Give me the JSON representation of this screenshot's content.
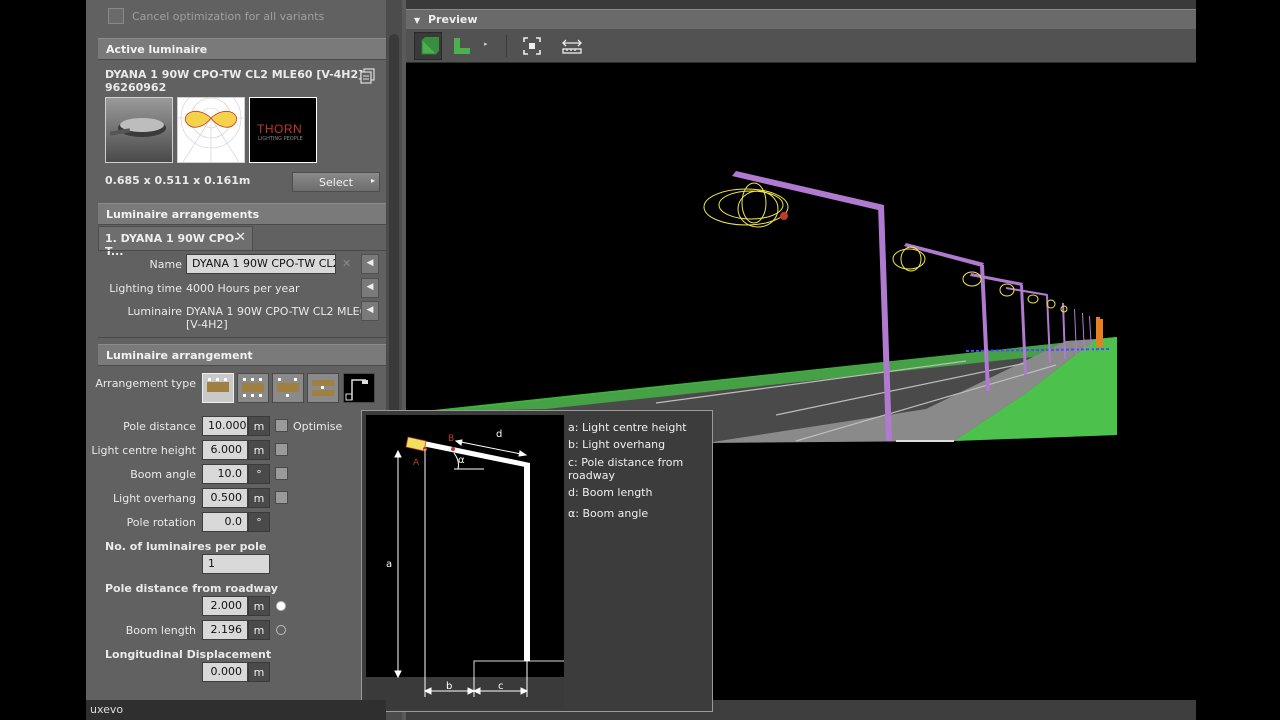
{
  "left_panel": {
    "cancel_label": "Cancel optimization for all variants",
    "active_luminaire": {
      "section_title": "Active luminaire",
      "name_line1": "DYANA 1 90W CPO-TW CL2 MLE60 [V-4H2]",
      "name_line2": "96260962",
      "dimensions": "0.685 x 0.511 x 0.161m",
      "select_label": "Select",
      "logo_text": "THORN",
      "logo_sub": "LIGHTING PEOPLE"
    },
    "arrangements": {
      "section_title": "Luminaire arrangements",
      "tab_label": "1. DYANA 1 90W CPO-T...",
      "tab_close": "✕",
      "name_label": "Name",
      "name_value": "DYANA 1 90W CPO-TW CL2 MLE60 [V-4H2]",
      "lighting_time_label": "Lighting time",
      "lighting_time_value": "4000 Hours per year",
      "luminaire_label": "Luminaire",
      "luminaire_value_line1": "DYANA 1 90W CPO-TW CL2 MLE60",
      "luminaire_value_line2": "[V-4H2]"
    },
    "arrangement": {
      "section_title": "Luminaire arrangement",
      "type_label": "Arrangement type",
      "pole_distance_label": "Pole distance",
      "pole_distance_value": "10.000",
      "pole_distance_unit": "m",
      "optimise_label": "Optimise",
      "light_centre_height_label": "Light centre height",
      "light_centre_height_value": "6.000",
      "light_centre_height_unit": "m",
      "boom_angle_label": "Boom angle",
      "boom_angle_value": "10.0",
      "boom_angle_unit": "°",
      "light_overhang_label": "Light overhang",
      "light_overhang_value": "0.500",
      "light_overhang_unit": "m",
      "pole_rotation_label": "Pole rotation",
      "pole_rotation_value": "0.0",
      "pole_rotation_unit": "°",
      "luminaires_per_pole_label": "No. of luminaires per pole",
      "luminaires_per_pole_value": "1",
      "pole_distance_roadway_label": "Pole distance from roadway",
      "pole_distance_roadway_value": "2.000",
      "pole_distance_roadway_unit": "m",
      "boom_length_label": "Boom length",
      "boom_length_value": "2.196",
      "boom_length_unit": "m",
      "longitudinal_label": "Longitudinal Displacement",
      "longitudinal_value": "0.000",
      "longitudinal_unit": "m"
    }
  },
  "preview": {
    "title": "Preview"
  },
  "tooltip": {
    "legend": [
      "a: Light centre height",
      "b: Light overhang",
      "c: Pole distance from roadway",
      "d: Boom length",
      "α: Boom angle"
    ],
    "diagram_letters": {
      "a": "a",
      "b": "b",
      "c": "c",
      "d": "d",
      "alpha": "α",
      "A": "A",
      "B": "B"
    }
  },
  "status": {
    "app_name": "uxevo"
  }
}
